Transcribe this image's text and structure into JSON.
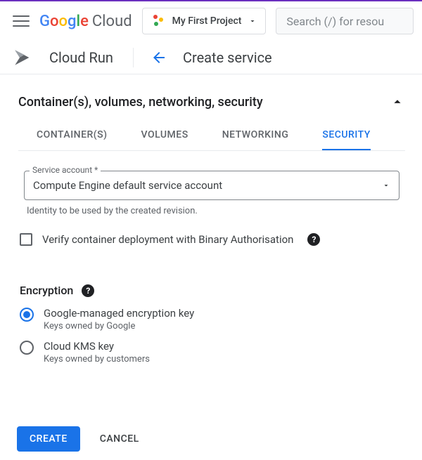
{
  "header": {
    "logo": {
      "google": [
        "G",
        "o",
        "o",
        "g",
        "l",
        "e"
      ],
      "cloud": "Cloud"
    },
    "project_name": "My First Project",
    "search_placeholder": "Search (/) for resou"
  },
  "subheader": {
    "service": "Cloud Run",
    "page_title": "Create service"
  },
  "section": {
    "title": "Container(s), volumes, networking, security",
    "tabs": [
      "CONTAINER(S)",
      "VOLUMES",
      "NETWORKING",
      "SECURITY"
    ],
    "active_tab_index": 3
  },
  "fields": {
    "service_account_label": "Service account *",
    "service_account_value": "Compute Engine default service account",
    "service_account_help": "Identity to be used by the created revision.",
    "binary_auth_label": "Verify container deployment with Binary Authorisation"
  },
  "encryption": {
    "title": "Encryption",
    "options": [
      {
        "title": "Google-managed encryption key",
        "sub": "Keys owned by Google",
        "selected": true
      },
      {
        "title": "Cloud KMS key",
        "sub": "Keys owned by customers",
        "selected": false
      }
    ]
  },
  "footer": {
    "create": "CREATE",
    "cancel": "CANCEL"
  },
  "icons": {
    "help": "?"
  },
  "colors": {
    "primary": "#1a73e8"
  }
}
